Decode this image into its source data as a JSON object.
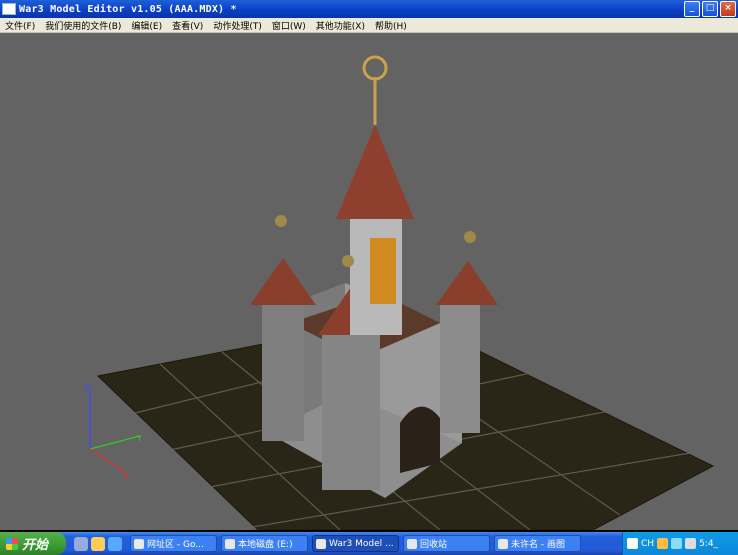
{
  "window": {
    "title": "War3 Model Editor v1.05 (AAA.MDX) *"
  },
  "menu": [
    "文件(F)",
    "我们使用的文件(B)",
    "编辑(E)",
    "查看(V)",
    "动作处理(T)",
    "窗口(W)",
    "其他功能(X)",
    "帮助(H)"
  ],
  "viewport": {
    "background": "#636363",
    "axes": {
      "z": "Z",
      "y": "Y",
      "x": "X"
    }
  },
  "taskbar": {
    "start_label": "开始",
    "tasks": [
      {
        "label": "网址区 - Go..."
      },
      {
        "label": "本地磁盘 (E:)"
      },
      {
        "label": "War3 Model ..."
      },
      {
        "label": "回收站"
      },
      {
        "label": "未许名 - 画图"
      }
    ],
    "tray": {
      "lang": "CH",
      "clock": "5:4_"
    }
  },
  "colors": {
    "titlebar": "#0a3fc4",
    "menubar": "#ece9d8",
    "taskbar": "#245edc",
    "start": "#3a9a34"
  }
}
